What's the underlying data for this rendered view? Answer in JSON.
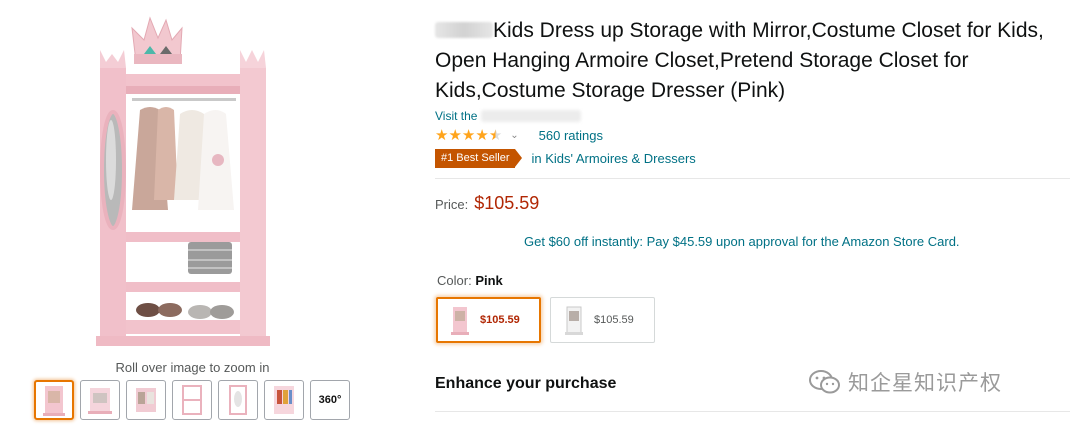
{
  "gallery": {
    "zoom_hint": "Roll over image to zoom in",
    "thumbnails": [
      "closet-front-thumb",
      "closet-angle-thumb",
      "closet-clothes-thumb",
      "closet-detail-thumb",
      "closet-mirror-thumb",
      "closet-lifestyle-thumb"
    ],
    "thumb_360_label": "360°",
    "active_index": 0
  },
  "product": {
    "title": "Kids Dress up Storage with Mirror,Costume Closet for Kids, Open Hanging Armoire Closet,Pretend Storage Closet for Kids,Costume Storage Dresser (Pink)",
    "store_prefix": "Visit the",
    "rating": 4.5,
    "ratings_count": "560 ratings",
    "badge": "#1 Best Seller",
    "badge_category": "in Kids' Armoires & Dressers",
    "price_label": "Price:",
    "price": "$105.59",
    "offer": "Get $60 off instantly: Pay $45.59 upon approval for the Amazon Store Card.",
    "color_label": "Color:",
    "color_value": "Pink",
    "swatches": [
      {
        "price": "$105.59",
        "selected": true
      },
      {
        "price": "$105.59",
        "selected": false
      }
    ],
    "enhance_heading": "Enhance your purchase"
  },
  "colors": {
    "link": "#007185",
    "price": "#b12704",
    "badge": "#c45500",
    "star": "#ffa41c",
    "selected_border": "#e77600"
  },
  "watermark": {
    "text": "知企星知识产权",
    "icon": "wechat-icon"
  }
}
